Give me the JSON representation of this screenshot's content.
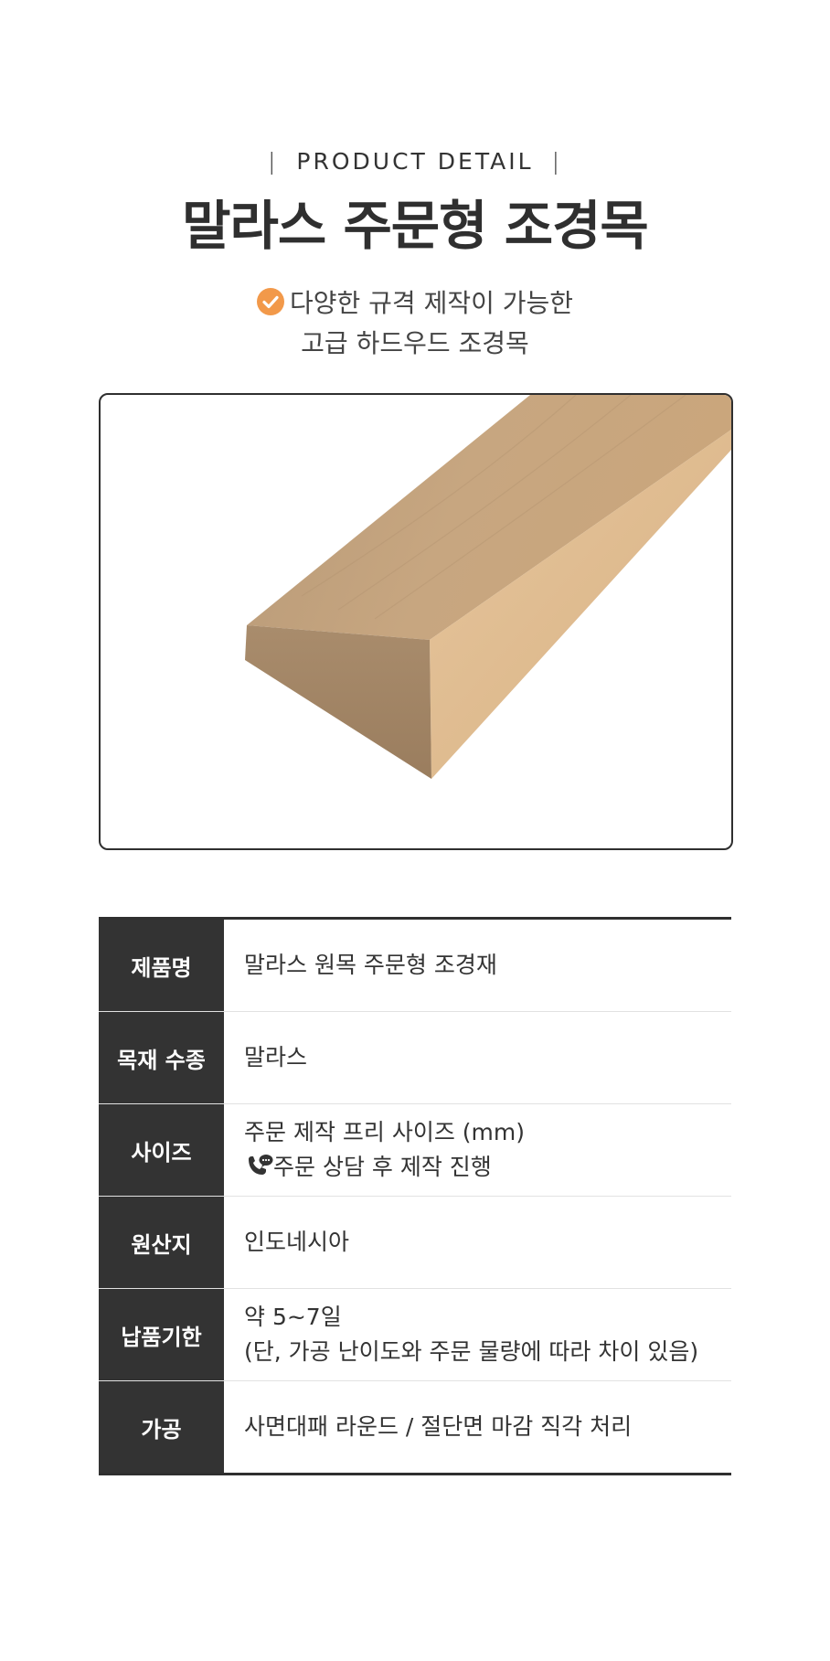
{
  "header": {
    "eyebrow": "PRODUCT DETAIL",
    "bar_left": "|",
    "bar_right": "|",
    "title": "말라스 주문형 조경목",
    "subtitle_line1": "다양한 규격 제작이 가능한",
    "subtitle_line2": "고급 하드우드 조경목",
    "check_icon": "check-circle-icon",
    "accent_color": "#f2994a"
  },
  "product_image": {
    "icon": "wood-plank-image"
  },
  "spec": {
    "rows": [
      {
        "label": "제품명",
        "value": "말라스 원목 주문형 조경재"
      },
      {
        "label": "목재 수종",
        "value": "말라스"
      },
      {
        "label": "사이즈",
        "value": "주문 제작 프리 사이즈 (mm)",
        "value2": "주문 상담 후 제작 진행",
        "icon": "phone-chat-icon"
      },
      {
        "label": "원산지",
        "value": "인도네시아"
      },
      {
        "label": "납품기한",
        "value": "약 5~7일",
        "value2": "(단, 가공 난이도와 주문 물량에 따라 차이 있음)"
      },
      {
        "label": "가공",
        "value": "사면대패 라운드 / 절단면 마감 직각 처리"
      }
    ],
    "header_color": "#333333"
  }
}
